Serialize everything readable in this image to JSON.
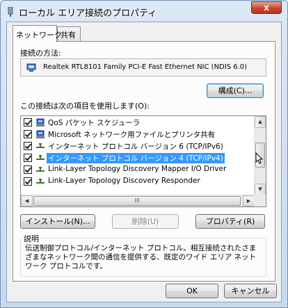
{
  "window": {
    "title": "ローカル エリア接続のプロパティ",
    "close_label": "x"
  },
  "tabs": [
    {
      "label": "ネットワーク",
      "active": true
    },
    {
      "label": "共有",
      "active": false
    }
  ],
  "connection": {
    "label": "接続の方法:",
    "adapter_name": "Realtek RTL8101 Family PCI-E Fast Ethernet NIC (NDIS 6.0)",
    "configure_label": "構成(C)..."
  },
  "items_section": {
    "label": "この接続は次の項目を使用します(O):",
    "items": [
      {
        "label": "QoS パケット スケジューラ",
        "checked": true,
        "icon": "network-client-icon",
        "selected": false
      },
      {
        "label": "Microsoft ネットワーク用ファイルとプリンタ共有",
        "checked": true,
        "icon": "network-client-icon",
        "selected": false
      },
      {
        "label": "インターネット プロトコル バージョン 6 (TCP/IPv6)",
        "checked": true,
        "icon": "protocol-icon",
        "selected": false
      },
      {
        "label": "インターネット プロトコル バージョン 4 (TCP/IPv4)",
        "checked": true,
        "icon": "protocol-icon",
        "selected": true
      },
      {
        "label": "Link-Layer Topology Discovery Mapper I/O Driver",
        "checked": true,
        "icon": "protocol-icon",
        "selected": false
      },
      {
        "label": "Link-Layer Topology Discovery Responder",
        "checked": true,
        "icon": "protocol-icon",
        "selected": false
      }
    ],
    "scroll_grip": "III"
  },
  "buttons": {
    "install": "インストール(N)...",
    "uninstall": "削除(U)",
    "properties": "プロパティ(R)",
    "ok": "OK",
    "cancel": "キャンセル"
  },
  "description": {
    "legend": "説明",
    "text": "伝送制御プロトコル/インターネット プロトコル。相互接続されたさまざまなネットワーク間の通信を提供する、既定のワイド エリア ネットワーク プロトコルです。"
  },
  "colors": {
    "selection": "#3399ff",
    "titlebar": "#c7daee",
    "close_button": "#c9452a"
  }
}
